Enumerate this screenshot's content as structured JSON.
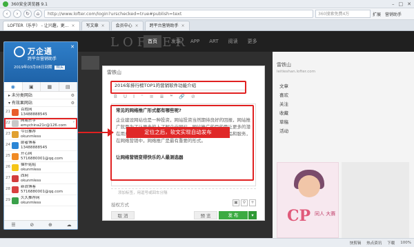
{
  "browser": {
    "title": "360安全浏览器 9.1",
    "url": "http://www.lofter.com/login?urschecked=true#publish=text",
    "search_placeholder": "360搜索免费4万",
    "ext_items": [
      "扩展",
      "营销助手"
    ],
    "tabs": [
      {
        "label": "LOFTER（乐乎） - 让兴趣，更..."
      },
      {
        "label": "写文章"
      },
      {
        "label": "会员中心"
      },
      {
        "label": "跨平台营销助手"
      }
    ]
  },
  "lofter": {
    "logo": "LOFTER",
    "nav": [
      "首页",
      "发现",
      "APP",
      "ART",
      "阅读",
      "更多"
    ],
    "right_user": "雷铁山",
    "right_domain": "leitieshan.lofter.com",
    "right_items": [
      "文章",
      "喜欢",
      "关注",
      "收藏",
      "草稿",
      "活动"
    ],
    "ad_text": "CP",
    "ad_sub": "同人\n大赛"
  },
  "editor": {
    "username": "雷铁山",
    "title": "2016年排行榜TOP1的营销软件功能介绍",
    "toolbar": [
      "B",
      "U",
      "I",
      "⁼",
      "≡",
      "≣",
      "❝",
      "🔗",
      "⊘"
    ],
    "heading1": "常见的网络推广形式都有哪些呢?",
    "para1": "企业建设网站也是一种投资，网站投资当然期待良好的回报，网站推广就是为了让更多的人了解企业网站，网站推广的目的是让更多的潜在用户来获得也们承载网络营销的信息，并了解企业的产品和服务，在网络营销中，网络推广是最有重要的形式。",
    "heading2": "让网络营销变得快乐的人最测选器",
    "tags_placeholder": "添加标签，用逗号或回车分隔",
    "license": "授权方式",
    "cancel": "取 消",
    "preview": "预 览",
    "publish": "发 布"
  },
  "callout": {
    "text": "定位之后，软文实现自动发布"
  },
  "assistant": {
    "name": "万企通",
    "subtitle": "跨平台营销助手",
    "date": "2019年03月08日到期",
    "badge1": "购买",
    "tabs": [
      "◉",
      "▣",
      "▦",
      "▤"
    ],
    "groups": [
      {
        "label": "未分类网站"
      },
      {
        "label": "有效果网站"
      }
    ],
    "rows": [
      {
        "num": "21",
        "name": "百姓网",
        "account": "13488888545",
        "color": "#e85d2c"
      },
      {
        "num": "22",
        "name": "网易乐乎",
        "account": "emychina21c@126.com",
        "color": "#c8c8c8",
        "selected": true
      },
      {
        "num": "23",
        "name": "今日推荐",
        "account": "okunmless",
        "color": "#e0a030"
      },
      {
        "num": "24",
        "name": "前者博客",
        "account": "13488888545",
        "color": "#2b86d6"
      },
      {
        "num": "25",
        "name": "开心网",
        "account": "5716880001@qq.com",
        "color": "#f08a24"
      },
      {
        "num": "26",
        "name": "猫扑贴贴",
        "account": "okunmless",
        "color": "#f5c518"
      },
      {
        "num": "27",
        "name": "西网",
        "account": "okunmless",
        "color": "#d23c3c"
      },
      {
        "num": "28",
        "name": "新浪博客",
        "account": "5716880001@qq.com",
        "color": "#d84040"
      },
      {
        "num": "29",
        "name": "久久推荐网",
        "account": "okunmless",
        "color": "#3aa04a"
      }
    ],
    "footer": [
      "☰",
      "⊘",
      "⊕",
      "☁"
    ]
  },
  "status": [
    "快剪辑",
    "热点资讯",
    "下载",
    "100%"
  ]
}
